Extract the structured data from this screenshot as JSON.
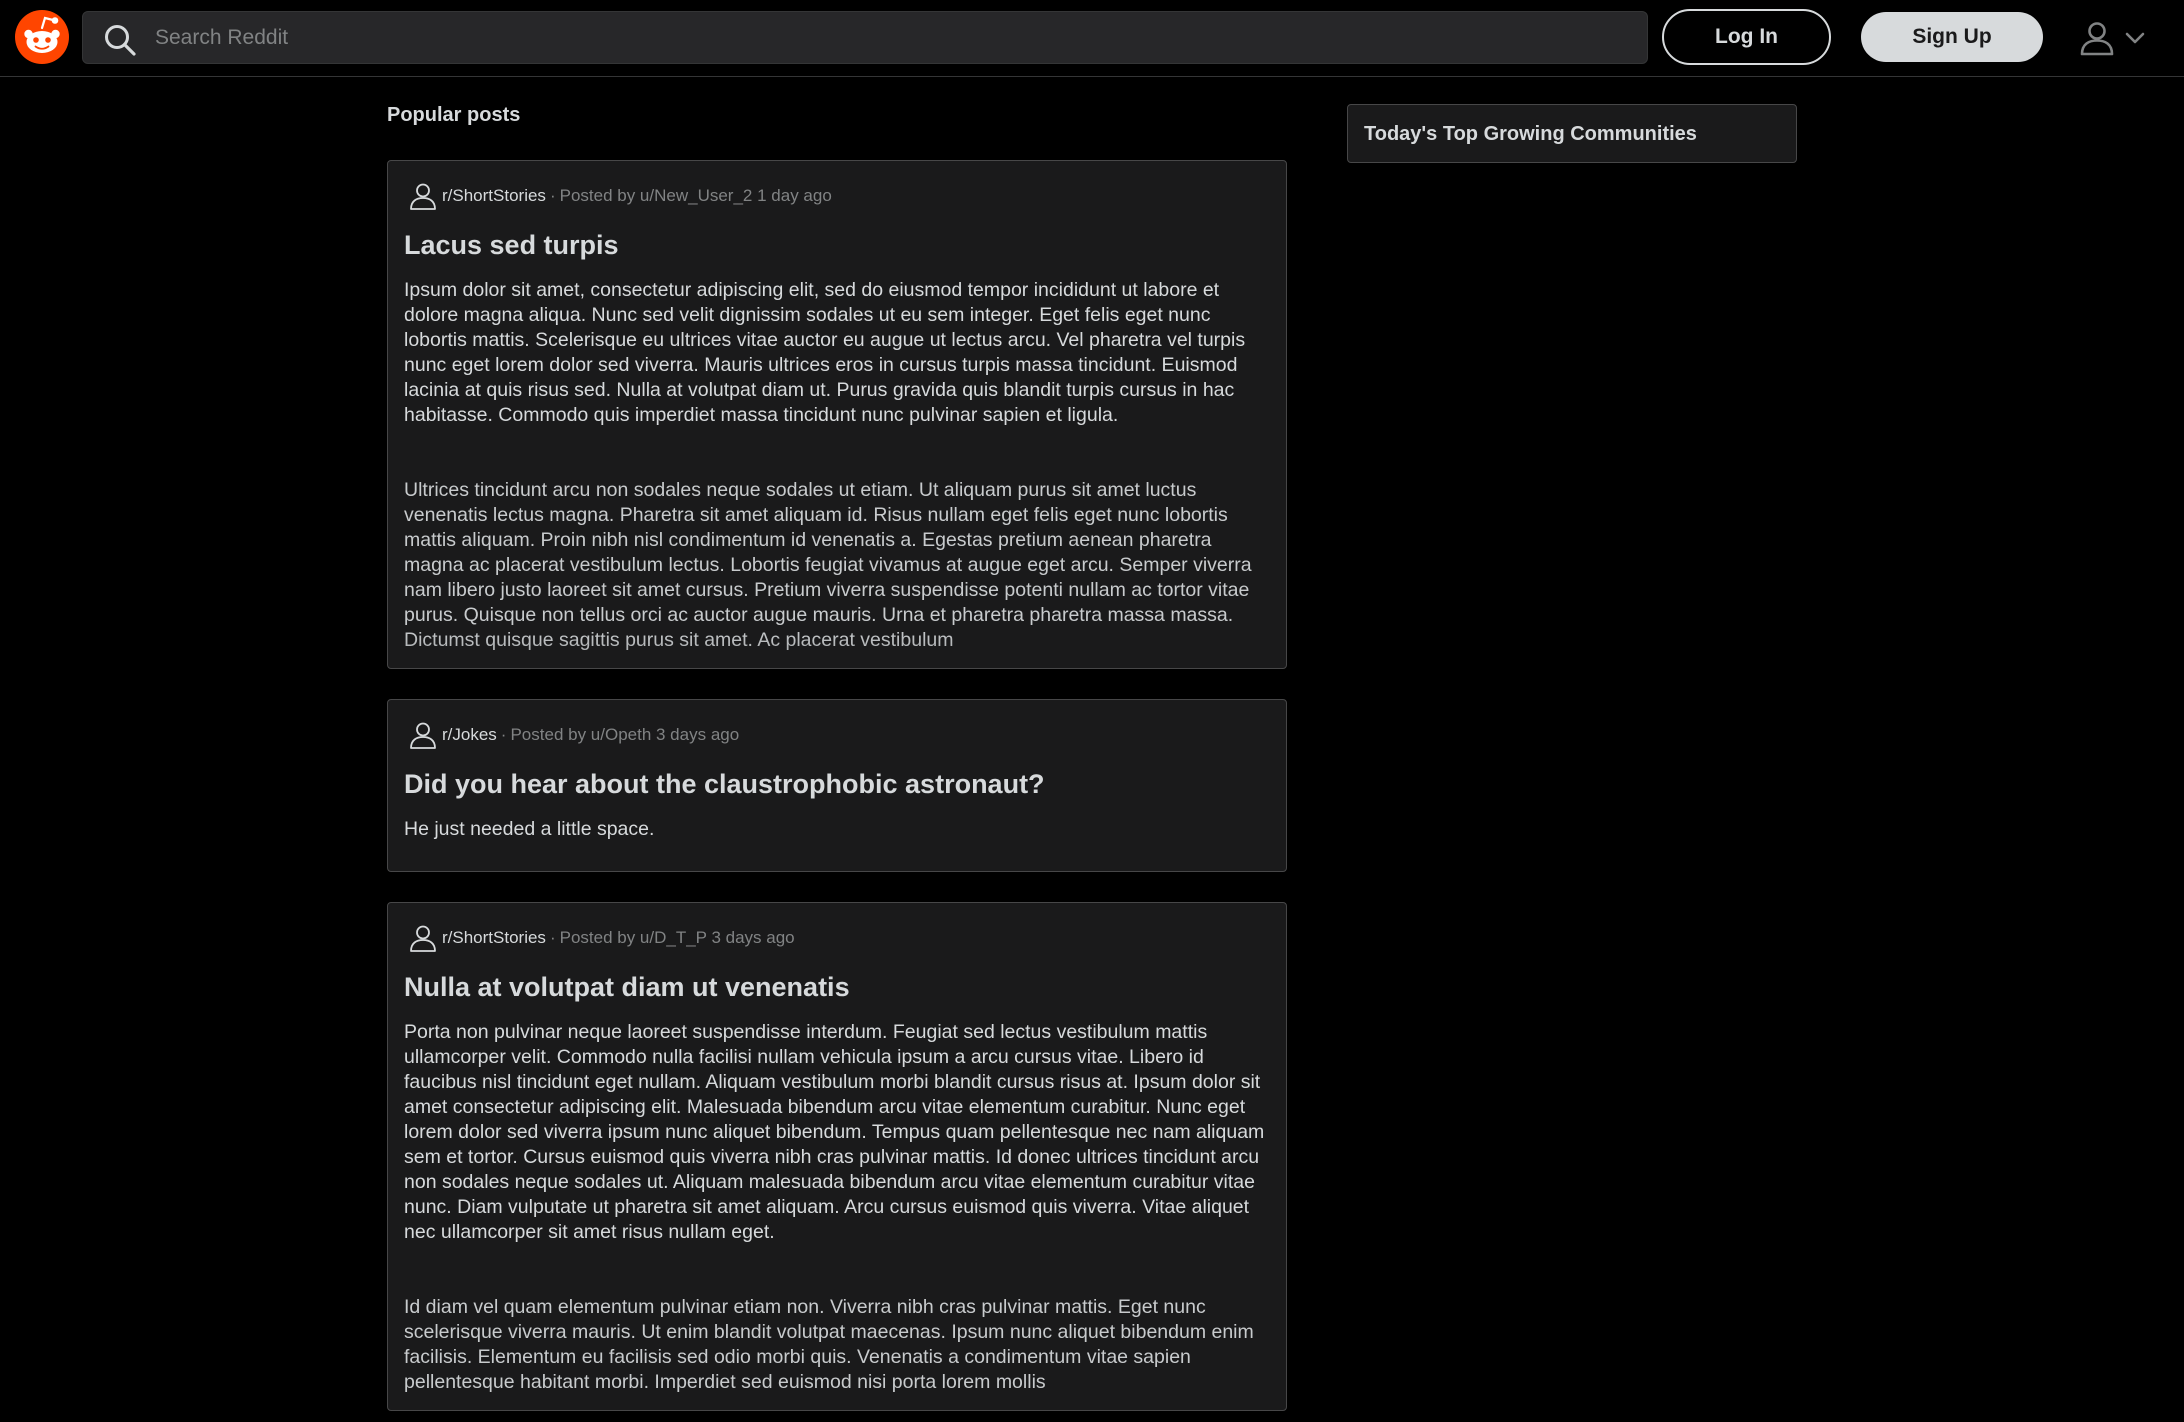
{
  "header": {
    "search_placeholder": "Search Reddit",
    "login_label": "Log In",
    "signup_label": "Sign Up"
  },
  "main": {
    "section_title": "Popular posts",
    "posts": [
      {
        "subreddit": "r/ShortStories",
        "separator": "·",
        "posted_by": "Posted by u/New_User_2 1 day ago",
        "title": "Lacus sed turpis",
        "body": [
          "Ipsum dolor sit amet, consectetur adipiscing elit, sed do eiusmod tempor incididunt ut labore et dolore magna aliqua. Nunc sed velit dignissim sodales ut eu sem integer. Eget felis eget nunc lobortis mattis. Scelerisque eu ultrices vitae auctor eu augue ut lectus arcu. Vel pharetra vel turpis nunc eget lorem dolor sed viverra. Mauris ultrices eros in cursus turpis massa tincidunt. Euismod lacinia at quis risus sed. Nulla at volutpat diam ut. Purus gravida quis blandit turpis cursus in hac habitasse. Commodo quis imperdiet massa tincidunt nunc pulvinar sapien et ligula.",
          "Ultrices tincidunt arcu non sodales neque sodales ut etiam. Ut aliquam purus sit amet luctus venenatis lectus magna. Pharetra sit amet aliquam id. Risus nullam eget felis eget nunc lobortis mattis aliquam. Proin nibh nisl condimentum id venenatis a. Egestas pretium aenean pharetra magna ac placerat vestibulum lectus. Lobortis feugiat vivamus at augue eget arcu. Semper viverra nam libero justo laoreet sit amet cursus. Pretium viverra suspendisse potenti nullam ac tortor vitae purus. Quisque non tellus orci ac auctor augue mauris. Urna et pharetra pharetra massa massa. Dictumst quisque sagittis purus sit amet. Ac placerat vestibulum"
        ]
      },
      {
        "subreddit": "r/Jokes",
        "separator": "·",
        "posted_by": "Posted by u/Opeth 3 days ago",
        "title": "Did you hear about the claustrophobic astronaut?",
        "body": [
          "He just needed a little space."
        ]
      },
      {
        "subreddit": "r/ShortStories",
        "separator": "·",
        "posted_by": "Posted by u/D_T_P 3 days ago",
        "title": "Nulla at volutpat diam ut venenatis",
        "body": [
          "Porta non pulvinar neque laoreet suspendisse interdum. Feugiat sed lectus vestibulum mattis ullamcorper velit. Commodo nulla facilisi nullam vehicula ipsum a arcu cursus vitae. Libero id faucibus nisl tincidunt eget nullam. Aliquam vestibulum morbi blandit cursus risus at. Ipsum dolor sit amet consectetur adipiscing elit. Malesuada bibendum arcu vitae elementum curabitur. Nunc eget lorem dolor sed viverra ipsum nunc aliquet bibendum. Tempus quam pellentesque nec nam aliquam sem et tortor. Cursus euismod quis viverra nibh cras pulvinar mattis. Id donec ultrices tincidunt arcu non sodales neque sodales ut. Aliquam malesuada bibendum arcu vitae elementum curabitur vitae nunc. Diam vulputate ut pharetra sit amet aliquam. Arcu cursus euismod quis viverra. Vitae aliquet nec ullamcorper sit amet risus nullam eget.",
          "Id diam vel quam elementum pulvinar etiam non. Viverra nibh cras pulvinar mattis. Eget nunc scelerisque viverra mauris. Ut enim blandit volutpat maecenas. Ipsum nunc aliquet bibendum enim facilisis. Elementum eu facilisis sed odio morbi quis. Venenatis a condimentum vitae sapien pellentesque habitant morbi. Imperdiet sed euismod nisi porta lorem mollis"
        ]
      }
    ]
  },
  "sidebar": {
    "title": "Today's Top Growing Communities"
  },
  "colors": {
    "brand": "#ff4500",
    "background": "#000000",
    "card": "#1a1a1b",
    "text": "#d7dadc",
    "muted": "#818384"
  }
}
